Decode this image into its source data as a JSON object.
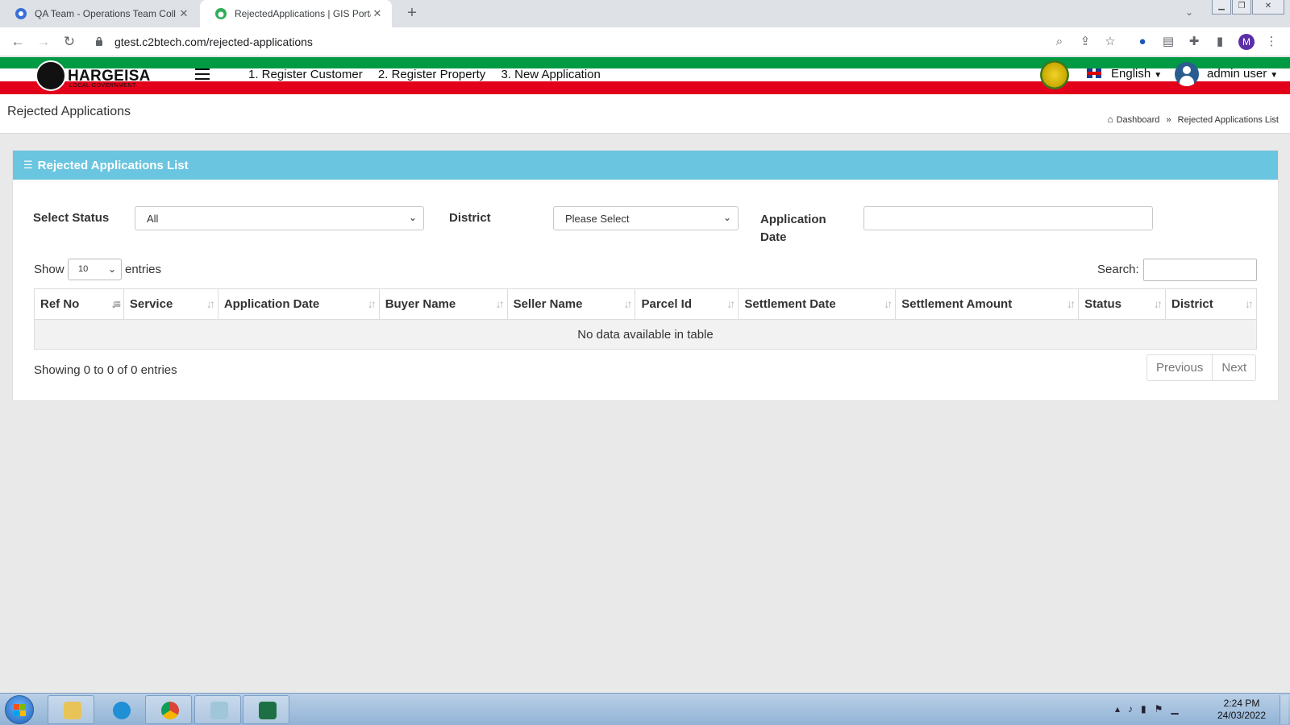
{
  "browser": {
    "tabs": [
      {
        "title": "QA Team - Operations Team Coll",
        "active": false
      },
      {
        "title": "RejectedApplications | GIS Portal",
        "active": true
      }
    ],
    "url": "gtest.c2btech.com/rejected-applications",
    "profile_initial": "M"
  },
  "header": {
    "logo_name": "HARGEISA",
    "logo_subtitle": "LOCAL GOVERNMENT",
    "nav": [
      "1. Register Customer",
      "2. Register Property",
      "3. New Application"
    ],
    "language": "English",
    "user": "admin user"
  },
  "page": {
    "title": "Rejected Applications",
    "breadcrumb": {
      "home": "Dashboard",
      "separator": "»",
      "current": "Rejected Applications List"
    }
  },
  "card": {
    "title": "Rejected Applications List",
    "filters": {
      "status_label": "Select Status",
      "status_value": "All",
      "district_label": "District",
      "district_value": "Please Select",
      "date_label_line1": "Application",
      "date_label_line2": "Date",
      "date_value": ""
    },
    "table": {
      "show_label": "Show",
      "page_length": "10",
      "entries_label": "entries",
      "search_label": "Search:",
      "columns": [
        "Ref No",
        "Service",
        "Application Date",
        "Buyer Name",
        "Seller Name",
        "Parcel Id",
        "Settlement Date",
        "Settlement Amount",
        "Status",
        "District"
      ],
      "empty_message": "No data available in table",
      "info": "Showing 0 to 0 of 0 entries",
      "previous": "Previous",
      "next": "Next"
    }
  },
  "taskbar": {
    "time": "2:24 PM",
    "date": "24/03/2022"
  },
  "colors": {
    "card_header": "#6ac5e0",
    "flag_green": "#009a44",
    "flag_red": "#e2001a"
  }
}
